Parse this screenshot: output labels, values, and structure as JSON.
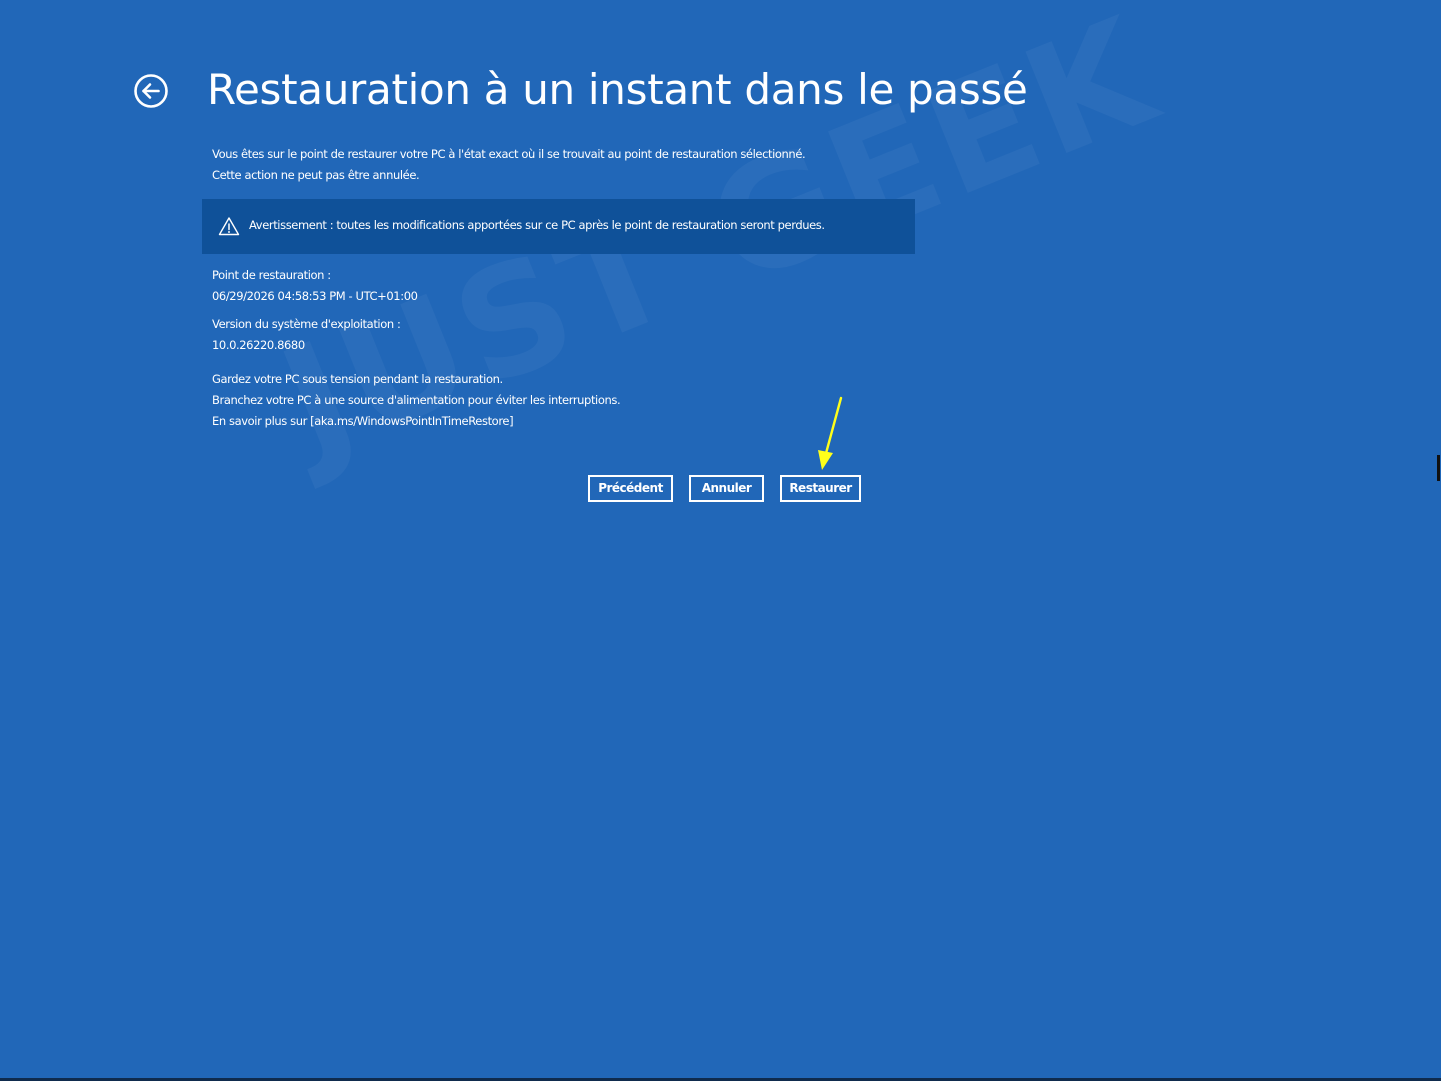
{
  "page": {
    "title": "Restauration à un instant dans le passé",
    "back_icon": "back-arrow-circle-icon"
  },
  "intro": {
    "line1": "Vous êtes sur le point de restaurer votre PC à l'état exact où il se trouvait au point de restauration sélectionné.",
    "line2": "Cette action ne peut pas être annulée."
  },
  "warning": {
    "icon": "warning-triangle-icon",
    "text": "Avertissement : toutes les modifications apportées sur ce PC après le point de restauration seront perdues."
  },
  "restore_point": {
    "label": "Point de restauration :",
    "value": "06/29/2026 04:58:53 PM - UTC+01:00"
  },
  "os_version": {
    "label": "Version du système d'exploitation :",
    "value": "10.0.26220.8680"
  },
  "notes": {
    "line1": "Gardez votre PC sous tension pendant la restauration.",
    "line2": "Branchez votre PC à une source d'alimentation pour éviter les interruptions.",
    "line3": "En savoir plus sur [aka.ms/WindowsPointInTimeRestore]"
  },
  "buttons": {
    "previous": "Précédent",
    "cancel": "Annuler",
    "restore": "Restaurer"
  },
  "annotation": {
    "arrow_color": "#ffff1a",
    "arrow_target": "restore-button"
  },
  "watermark": {
    "text": "JUST GEEK"
  },
  "colors": {
    "background": "#2167b8",
    "warning_box": "#0f5199",
    "text": "#ffffff"
  }
}
